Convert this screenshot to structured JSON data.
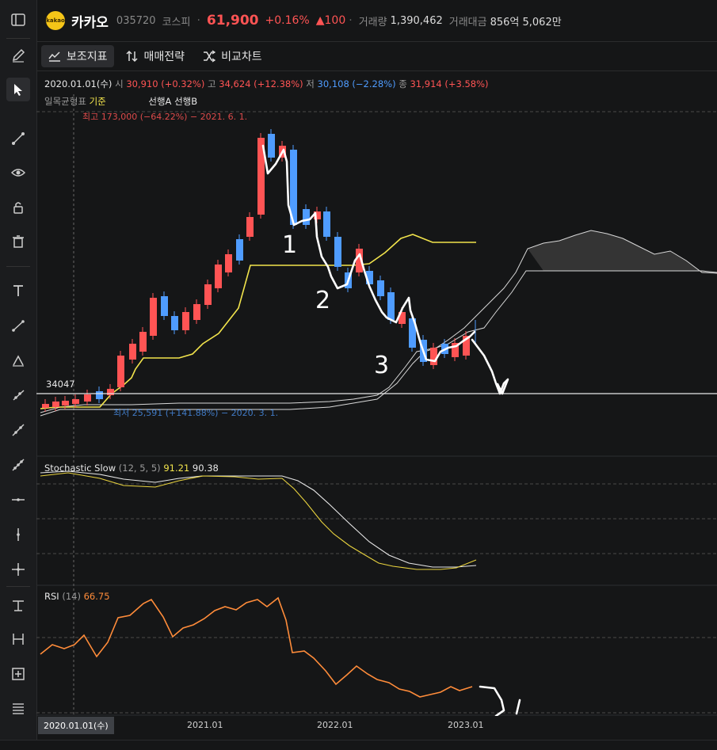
{
  "header": {
    "logo_text": "kakao",
    "name": "카카오",
    "code": "035720",
    "market": "코스피",
    "price": "61,900",
    "change_pct": "+0.16%",
    "change_abs": "▲100",
    "volume_label": "거래량",
    "volume": "1,390,462",
    "amount_label": "거래대금",
    "amount": "856억 5,062만"
  },
  "toolbar": {
    "indicators": "보조지표",
    "strategy": "매매전략",
    "compare": "비교차트"
  },
  "ohlc": {
    "date": "2020.01.01(수)",
    "open_label": "시",
    "open": "30,910 (+0.32%)",
    "high_label": "고",
    "high": "34,624 (+12.38%)",
    "low_label": "저",
    "low": "30,108 (−2.28%)",
    "close_label": "종",
    "close": "31,914 (+3.58%)"
  },
  "ichimoku": {
    "label": "일목균형표",
    "base": "기준",
    "spans": "선행A 선행B"
  },
  "annotations": {
    "high_marker": "최고 173,000 (−64.22%) − 2021. 6. 1.",
    "low_marker": "최저 25,591 (+141.88%) − 2020. 3. 1.",
    "price_line": "34047"
  },
  "stochastic": {
    "label": "Stochastic Slow",
    "params": "(12, 5, 5)",
    "k": "91.21",
    "d": "90.38"
  },
  "rsi": {
    "label": "RSI",
    "params": "(14)",
    "value": "66.75"
  },
  "xaxis": {
    "cursor_date": "2020.01.01(수)",
    "ticks": [
      "2021.01",
      "2022.01",
      "2023.01"
    ]
  },
  "handwriting": [
    "1",
    "2",
    "3"
  ],
  "colors": {
    "up": "#ff5454",
    "down": "#4f9cff",
    "base_line": "#f2e44c",
    "rsi": "#ff8c3a",
    "background": "#151617"
  }
}
